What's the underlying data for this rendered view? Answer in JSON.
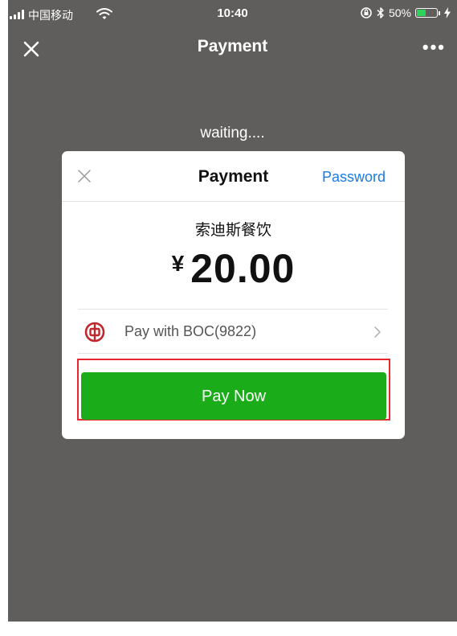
{
  "status_bar": {
    "carrier": "中国移动",
    "time": "10:40",
    "battery_text": "50%",
    "battery_level": 0.5,
    "icons": [
      "signal-icon",
      "wifi-icon",
      "lock-rotation-icon",
      "bluetooth-icon",
      "battery-icon",
      "charging-icon"
    ]
  },
  "nav": {
    "title": "Payment",
    "close_icon": "close-icon",
    "more_icon": "more-icon"
  },
  "waiting_text": "waiting....",
  "dialog": {
    "title": "Payment",
    "password_link": "Password",
    "merchant": "索迪斯餐饮",
    "currency": "¥",
    "amount": "20.00",
    "pay_method": "Pay with BOC(9822)",
    "pay_button": "Pay Now"
  },
  "colors": {
    "pay_button": "#1aad19",
    "highlight_frame": "#e8262f",
    "link": "#1b7be3",
    "overlay": "#5f5e5c",
    "bank_icon": "#c0272d"
  }
}
